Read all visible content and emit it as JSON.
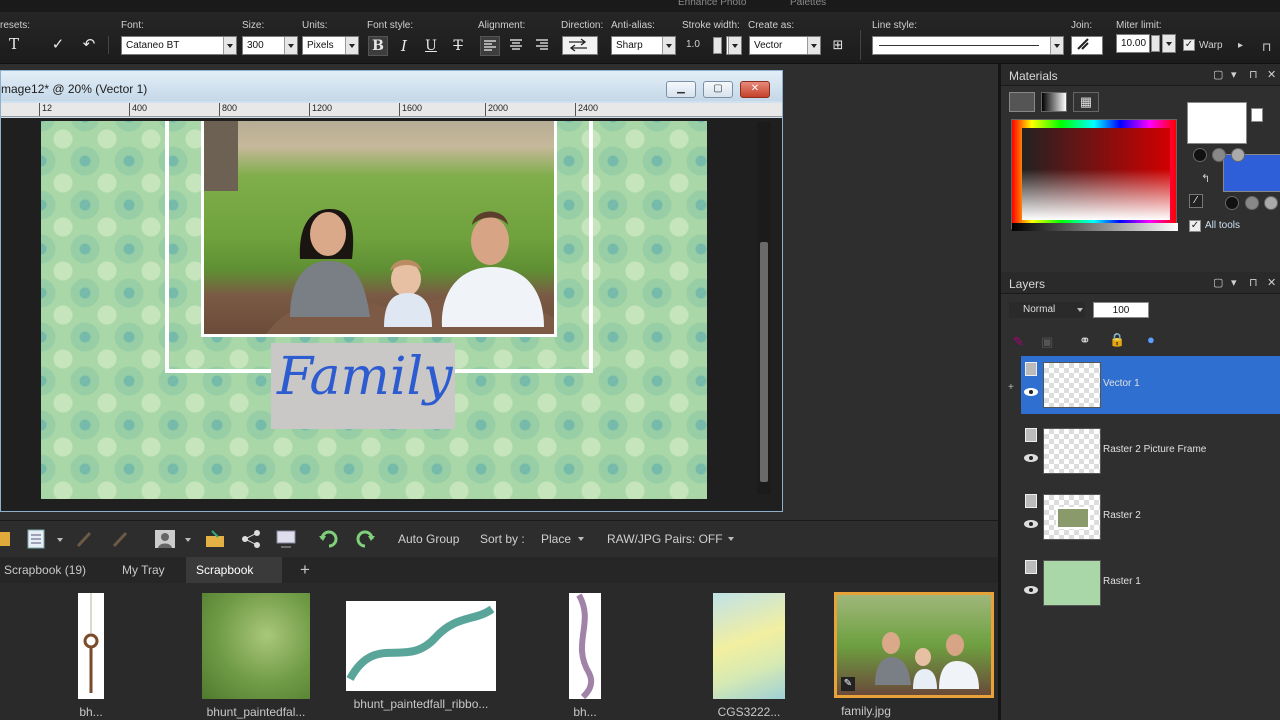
{
  "top": {
    "menu_tabs": [
      "Enhance Photo",
      "Palettes"
    ]
  },
  "toolbar": {
    "presets_label": "resets:",
    "font_label": "Font:",
    "font_value": "Cataneo BT",
    "size_label": "Size:",
    "size_value": "300",
    "units_label": "Units:",
    "units_value": "Pixels",
    "font_style_label": "Font style:",
    "alignment_label": "Alignment:",
    "direction_label": "Direction:",
    "antialias_label": "Anti-alias:",
    "antialias_value": "Sharp",
    "stroke_label": "Stroke width:",
    "stroke_value": "1.0",
    "create_as_label": "Create as:",
    "create_as_value": "Vector",
    "line_style_label": "Line style:",
    "join_label": "Join:",
    "miter_label": "Miter limit:",
    "miter_value": "10.00",
    "warp_label": "Warp",
    "bold_glyph": "B",
    "italic_glyph": "I",
    "underline_glyph": "U",
    "strike_glyph": "T",
    "text_tool_glyph": "T"
  },
  "document": {
    "title": "mage12* @  20% (Vector 1)",
    "ruler_ticks": [
      "12",
      "400",
      "800",
      "1200",
      "1600",
      "2000",
      "2400"
    ],
    "family_text": "Family"
  },
  "organizer": {
    "auto_group": "Auto Group",
    "sort_by": "Sort by :",
    "sort_value": "Place",
    "raw_pairs": "RAW/JPG Pairs: OFF",
    "tabs": [
      {
        "label": "Scrapbook (19)"
      },
      {
        "label": "My Tray"
      },
      {
        "label": "Scrapbook"
      }
    ],
    "add_tab": "+",
    "items": [
      {
        "caption": "bh..."
      },
      {
        "caption": "bhunt_paintedfal..."
      },
      {
        "caption": "bhunt_paintedfall_ribbo..."
      },
      {
        "caption": "bh..."
      },
      {
        "caption": "CGS3222..."
      },
      {
        "caption": "family.jpg"
      }
    ]
  },
  "materials": {
    "title": "Materials",
    "all_tools": "All tools",
    "foreground_color": "#ffffff",
    "background_color": "#2f5fd8"
  },
  "layers": {
    "title": "Layers",
    "blend_mode": "Normal",
    "opacity": "100",
    "rows": [
      {
        "name": "Vector 1",
        "selected": true
      },
      {
        "name": "Raster 2 Picture Frame",
        "selected": false
      },
      {
        "name": "Raster 2",
        "selected": false
      },
      {
        "name": "Raster 1",
        "selected": false
      }
    ]
  },
  "colors": {
    "accent": "#2f6fd0",
    "selection_orange": "#e8a23a",
    "family_text_color": "#2d5bd0",
    "page_green": "#a9d7a8"
  }
}
